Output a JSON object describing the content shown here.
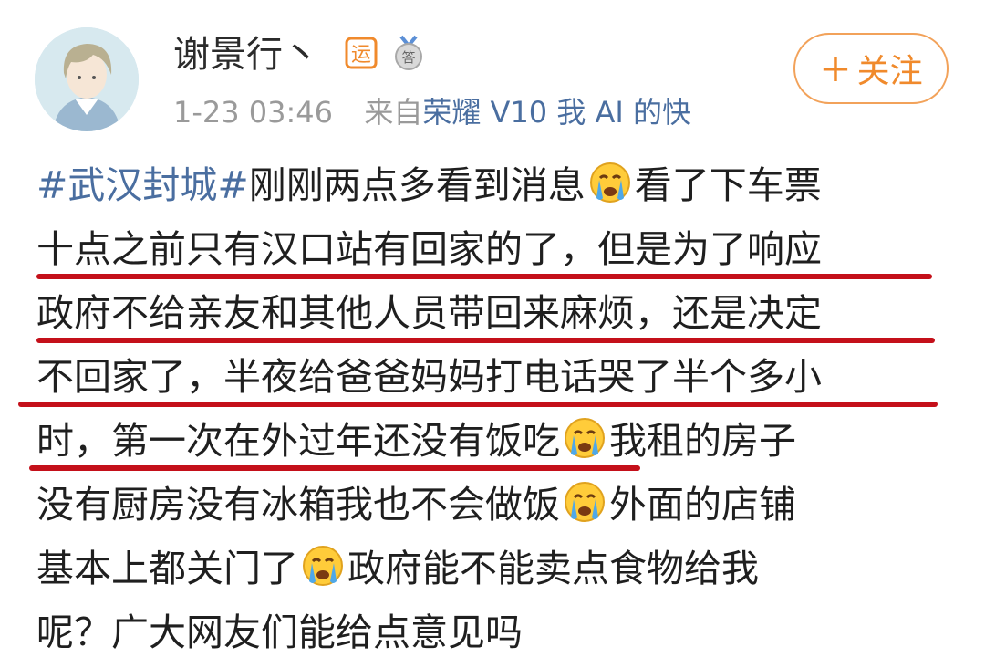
{
  "user": {
    "name": "谢景行丶",
    "badges": [
      "运",
      "答"
    ]
  },
  "follow_button": {
    "label": "+关注",
    "plus": "+",
    "text": "关注"
  },
  "meta": {
    "time": "1-23 03:46",
    "from": "来自",
    "device": "荣耀 V10 我 AI 的快"
  },
  "post": {
    "hashtag": "#武汉封城#",
    "line1_a": "刚刚两点多看到消息",
    "line1_b": "看了下车票",
    "line2": "十点之前只有汉口站有回家的了，但是为了响应",
    "line3": "政府不给亲友和其他人员带回来麻烦，还是决定",
    "line4": "不回家了，半夜给爸爸妈妈打电话哭了半个多小",
    "line5_a": "时，第一次在外过年还没有饭吃",
    "line5_b": "我租的房子",
    "line6_a": "没有厨房没有冰箱我也不会做饭",
    "line6_b": "外面的店铺",
    "line7_a": "基本上都关门了",
    "line7_b": "政府能不能卖点食物给我",
    "line8": "呢？广大网友们能给点意见吗"
  },
  "colors": {
    "link": "#4a6ea0",
    "follow": "#f08a2c",
    "underline": "#c4101a",
    "meta": "#9a9a9a"
  },
  "icons": [
    "avatar",
    "sport-badge-icon",
    "answer-medal-icon",
    "crying-face-emoji"
  ]
}
